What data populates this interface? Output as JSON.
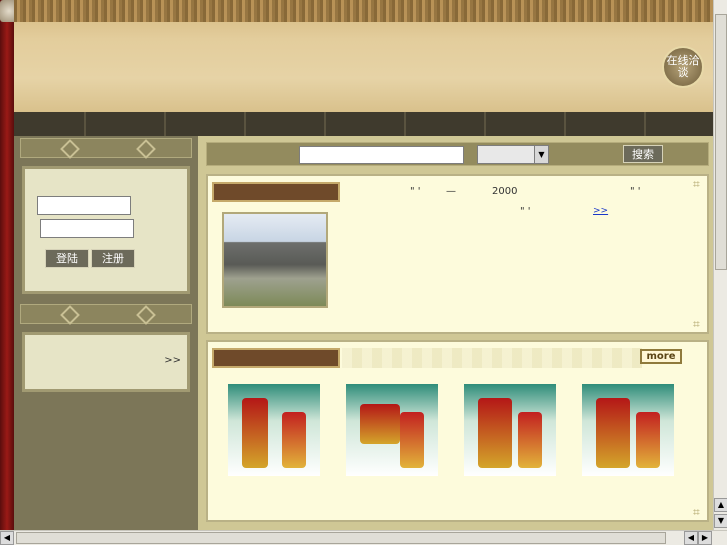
{
  "banner": {
    "online_badge": "在线洽谈"
  },
  "login": {
    "login_button": "登陆",
    "register_button": "注册"
  },
  "links_box": {
    "arrow": ">>"
  },
  "search": {
    "placeholder": "",
    "select_value": "",
    "button": "搜索"
  },
  "intro": {
    "line1_a": "\" '",
    "line1_b": "—",
    "line1_c": "2000",
    "line1_d": "\" '",
    "line2_a": "\" '",
    "more": ">>"
  },
  "products": {
    "more": "more"
  },
  "colors": {
    "accent": "#6f4a2a",
    "link": "#1a37c9"
  }
}
